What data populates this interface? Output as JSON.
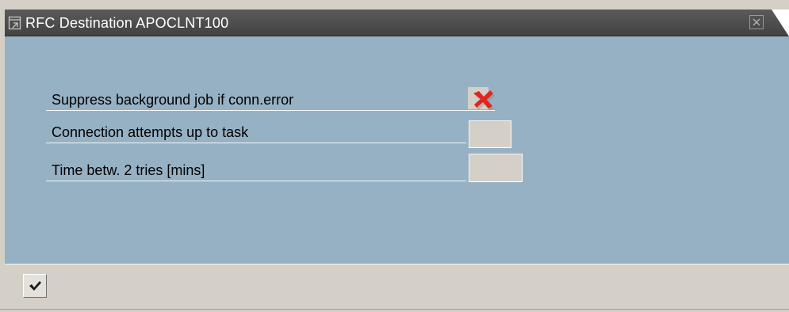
{
  "window": {
    "title": "RFC Destination APOCLNT100",
    "title_icon": "popup-window-icon",
    "close_icon": "close-icon"
  },
  "form": {
    "rows": [
      {
        "label": "Suppress background job if conn.error",
        "type": "checkbox",
        "checked": true
      },
      {
        "label": "Connection attempts up to task",
        "type": "input",
        "value": ""
      },
      {
        "label": "Time betw. 2 tries [mins]",
        "type": "input",
        "value": ""
      }
    ]
  },
  "toolbar": {
    "confirm_icon": "checkmark-icon"
  },
  "colors": {
    "titlebar": "#4a4a4a",
    "content_bg": "#97b1c4",
    "toolbar_bg": "#d4d0c8",
    "check_mark": "#e0261e"
  }
}
